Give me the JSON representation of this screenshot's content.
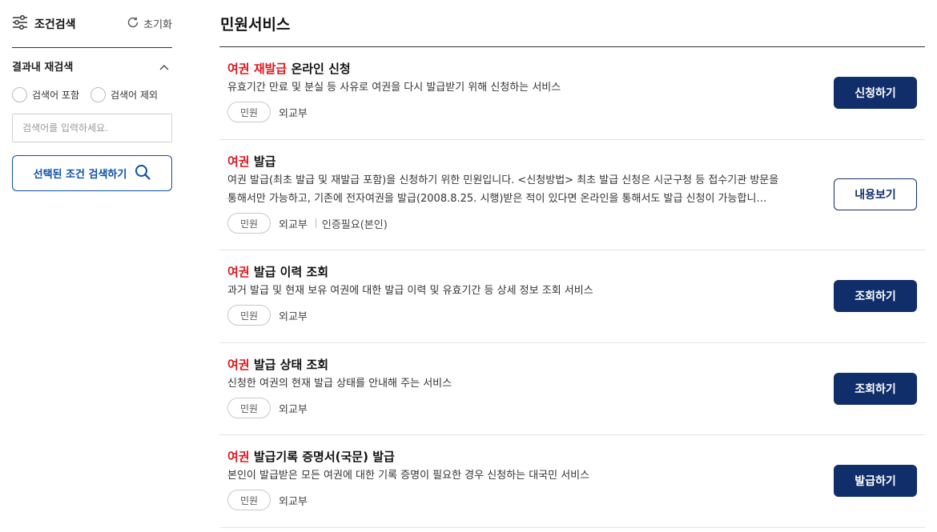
{
  "sidebar": {
    "filter_label": "조건검색",
    "reset_label": "초기화",
    "refine_label": "결과내 재검색",
    "include_label": "검색어 포함",
    "exclude_label": "검색어 제외",
    "search_placeholder": "검색어를 입력하세요.",
    "search_button_label": "선택된 조건 검색하기"
  },
  "main": {
    "title": "민원서비스",
    "items": [
      {
        "title_highlight": "여권 재발급",
        "title_rest": " 온라인 신청",
        "desc_line1": "유효기간 만료 및 분실 등 사유로 여권을 다시 발급받기 위해 신청하는 서비스",
        "desc_line2": "",
        "tag": "민원",
        "org": "외교부",
        "extra": "",
        "button": "신청하기"
      },
      {
        "title_highlight": "여권",
        "title_rest": " 발급",
        "desc_line1": "여권 발급(최초 발급 및 재발급 포함)을 신청하기 위한 민원입니다. <신청방법> 최초 발급 신청은 시군구청 등 접수기관 방문을",
        "desc_line2": "통해서만 가능하고, 기존에 전자여권을 발급(2008.8.25. 시행)받은 적이 있다면 온라인을 통해서도 발급 신청이 가능합니…",
        "tag": "민원",
        "org": "외교부",
        "extra": "인증필요(본인)",
        "button": "내용보기"
      },
      {
        "title_highlight": "여권",
        "title_rest": " 발급 이력 조회",
        "desc_line1": "과거 발급 및 현재 보유 여권에 대한 발급 이력 및 유효기간 등 상세 정보 조회 서비스",
        "desc_line2": "",
        "tag": "민원",
        "org": "외교부",
        "extra": "",
        "button": "조회하기"
      },
      {
        "title_highlight": "여권",
        "title_rest": " 발급 상태 조회",
        "desc_line1": "신청한 여권의 현재 발급 상태를 안내해 주는 서비스",
        "desc_line2": "",
        "tag": "민원",
        "org": "외교부",
        "extra": "",
        "button": "조회하기"
      },
      {
        "title_highlight": "여권",
        "title_rest": " 발급기록 증명서(국문) 발급",
        "desc_line1": "본인이 발급받은 모든 여권에 대한 기록 증명이 필요한 경우 신청하는 대국민 서비스",
        "desc_line2": "",
        "tag": "민원",
        "org": "외교부",
        "extra": "",
        "button": "발급하기"
      }
    ]
  },
  "colors": {
    "highlight": "#e0151b",
    "primary": "#102e6a",
    "accent_blue": "#0b4fa8"
  }
}
